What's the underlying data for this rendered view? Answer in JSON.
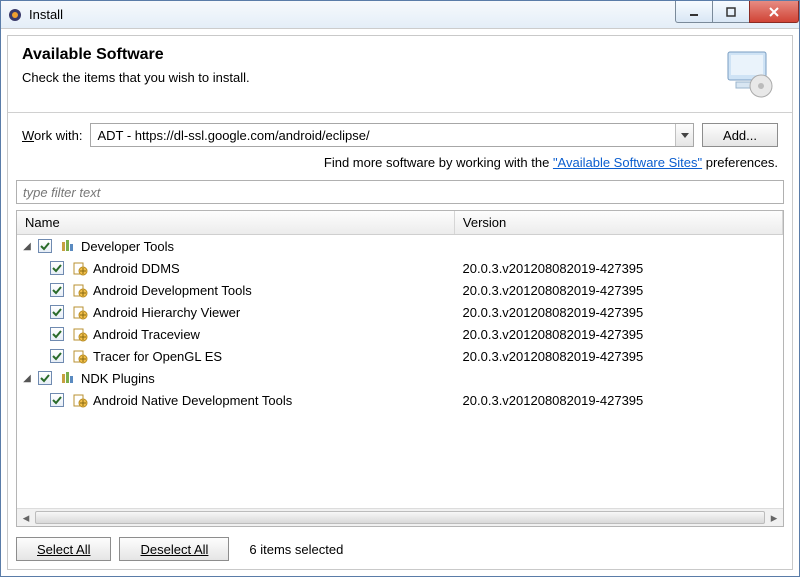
{
  "window": {
    "title": "Install"
  },
  "banner": {
    "heading": "Available Software",
    "subtitle": "Check the items that you wish to install."
  },
  "work_with": {
    "label_pre": "W",
    "label_post": "ork with:",
    "value": "ADT - https://dl-ssl.google.com/android/eclipse/",
    "add_label": "Add..."
  },
  "hint": {
    "pre": "Find more software by working with the ",
    "link": "\"Available Software Sites\"",
    "post": " preferences."
  },
  "filter_placeholder": "type filter text",
  "columns": {
    "name": "Name",
    "version": "Version"
  },
  "tree": [
    {
      "type": "group",
      "label": "Developer Tools",
      "checked": true,
      "expanded": true
    },
    {
      "type": "item",
      "label": "Android DDMS",
      "version": "20.0.3.v201208082019-427395",
      "checked": true
    },
    {
      "type": "item",
      "label": "Android Development Tools",
      "version": "20.0.3.v201208082019-427395",
      "checked": true
    },
    {
      "type": "item",
      "label": "Android Hierarchy Viewer",
      "version": "20.0.3.v201208082019-427395",
      "checked": true
    },
    {
      "type": "item",
      "label": "Android Traceview",
      "version": "20.0.3.v201208082019-427395",
      "checked": true
    },
    {
      "type": "item",
      "label": "Tracer for OpenGL ES",
      "version": "20.0.3.v201208082019-427395",
      "checked": true
    },
    {
      "type": "group",
      "label": "NDK Plugins",
      "checked": true,
      "expanded": true
    },
    {
      "type": "item",
      "label": "Android Native Development Tools",
      "version": "20.0.3.v201208082019-427395",
      "checked": true
    }
  ],
  "footer": {
    "select_all": "Select All",
    "deselect_all": "Deselect All",
    "status": "6 items selected"
  }
}
